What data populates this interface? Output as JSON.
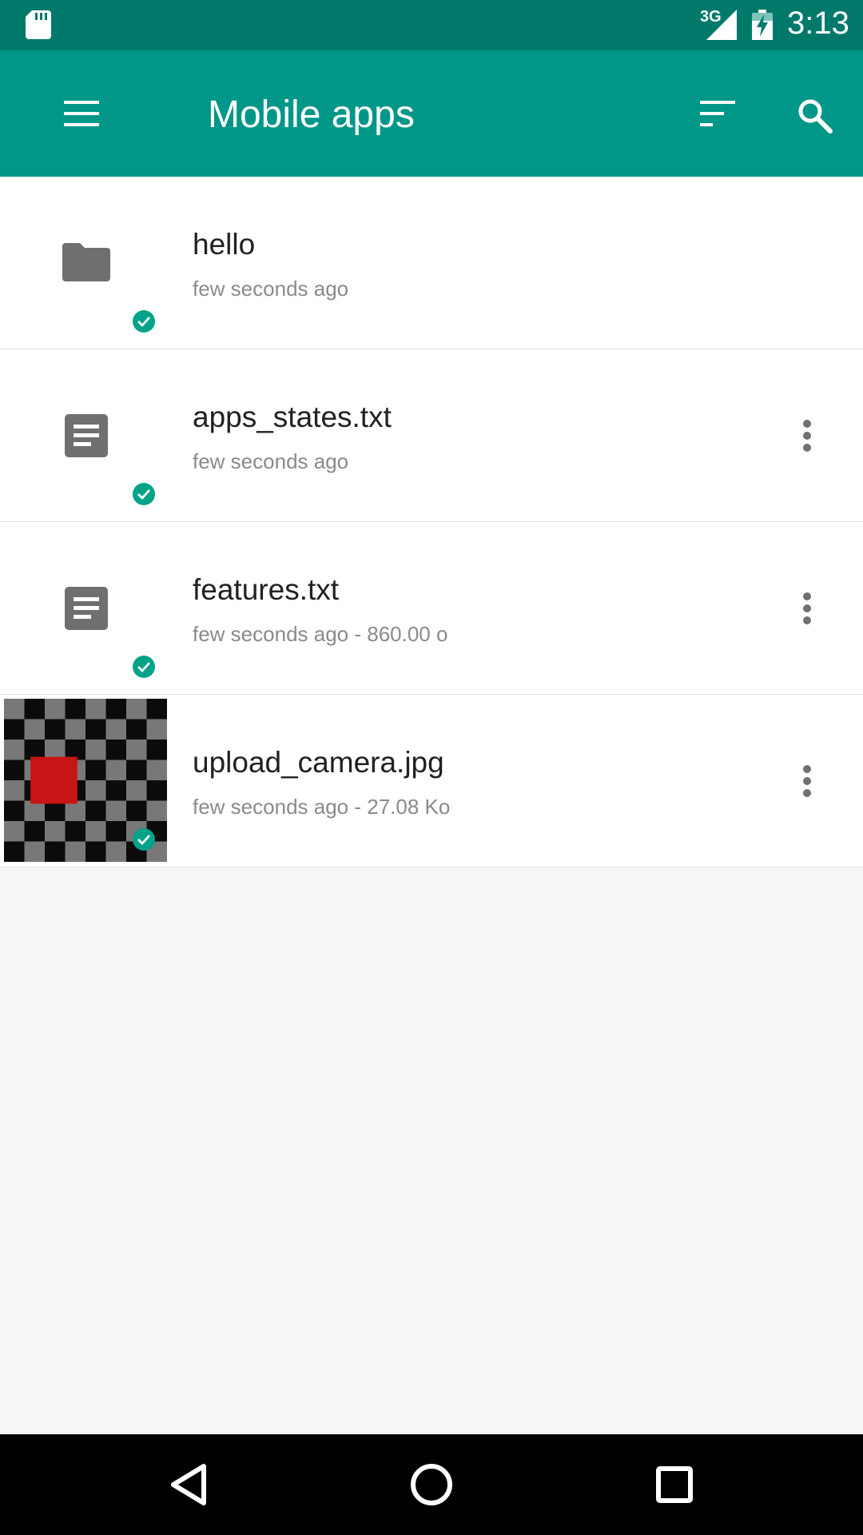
{
  "status_bar": {
    "network": "3G",
    "time": "3:13"
  },
  "toolbar": {
    "title": "Mobile apps",
    "menu_icon": "hamburger-menu-icon",
    "sort_icon": "sort-icon",
    "search_icon": "search-icon"
  },
  "files": [
    {
      "name": "hello",
      "meta": "few seconds ago",
      "type": "folder",
      "synced": true,
      "has_menu": false
    },
    {
      "name": "apps_states.txt",
      "meta": "few seconds ago",
      "type": "text",
      "synced": true,
      "has_menu": true
    },
    {
      "name": "features.txt",
      "meta": "few seconds ago  -  860.00 o",
      "type": "text",
      "synced": true,
      "has_menu": true
    },
    {
      "name": "upload_camera.jpg",
      "meta": "few seconds ago  -  27.08 Ko",
      "type": "image",
      "synced": true,
      "has_menu": true
    }
  ],
  "colors": {
    "primary": "#009688",
    "primary_dark": "#00796b",
    "accent_check": "#00a389",
    "icon_grey": "#6f6f6f"
  },
  "nav_bar": {
    "back_icon": "back-triangle-icon",
    "home_icon": "home-circle-icon",
    "recents_icon": "recents-square-icon"
  }
}
